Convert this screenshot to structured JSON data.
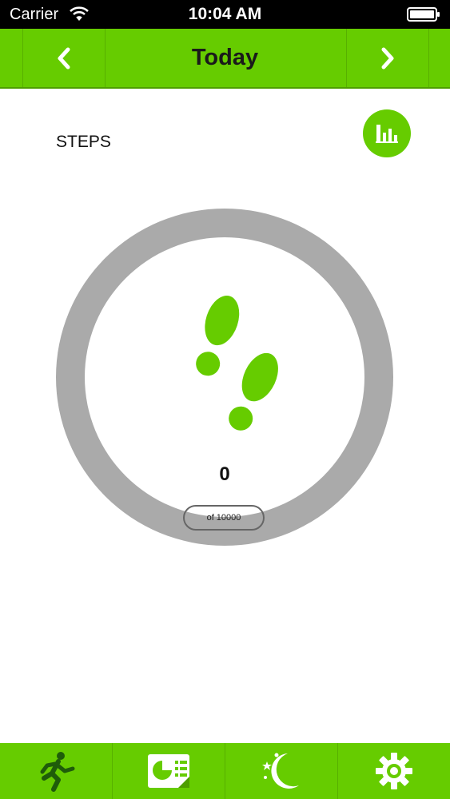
{
  "status_bar": {
    "carrier": "Carrier",
    "time": "10:04 AM",
    "icons": [
      "wifi-icon",
      "battery-icon"
    ]
  },
  "nav": {
    "title": "Today",
    "prev_icon": "chevron-left-icon",
    "next_icon": "chevron-right-icon"
  },
  "main": {
    "section_label": "STEPS",
    "chart_button_icon": "bar-chart-icon",
    "ring_icon": "footprints-icon",
    "step_count": "0",
    "goal_text": "of 10000",
    "progress_fraction": 0
  },
  "tabs": [
    {
      "icon": "running-man-icon"
    },
    {
      "icon": "report-card-icon"
    },
    {
      "icon": "moon-stars-icon"
    },
    {
      "icon": "gear-icon"
    }
  ],
  "colors": {
    "accent": "#66cc00",
    "ring": "#aaaaaa",
    "status_bar": "#000000"
  }
}
